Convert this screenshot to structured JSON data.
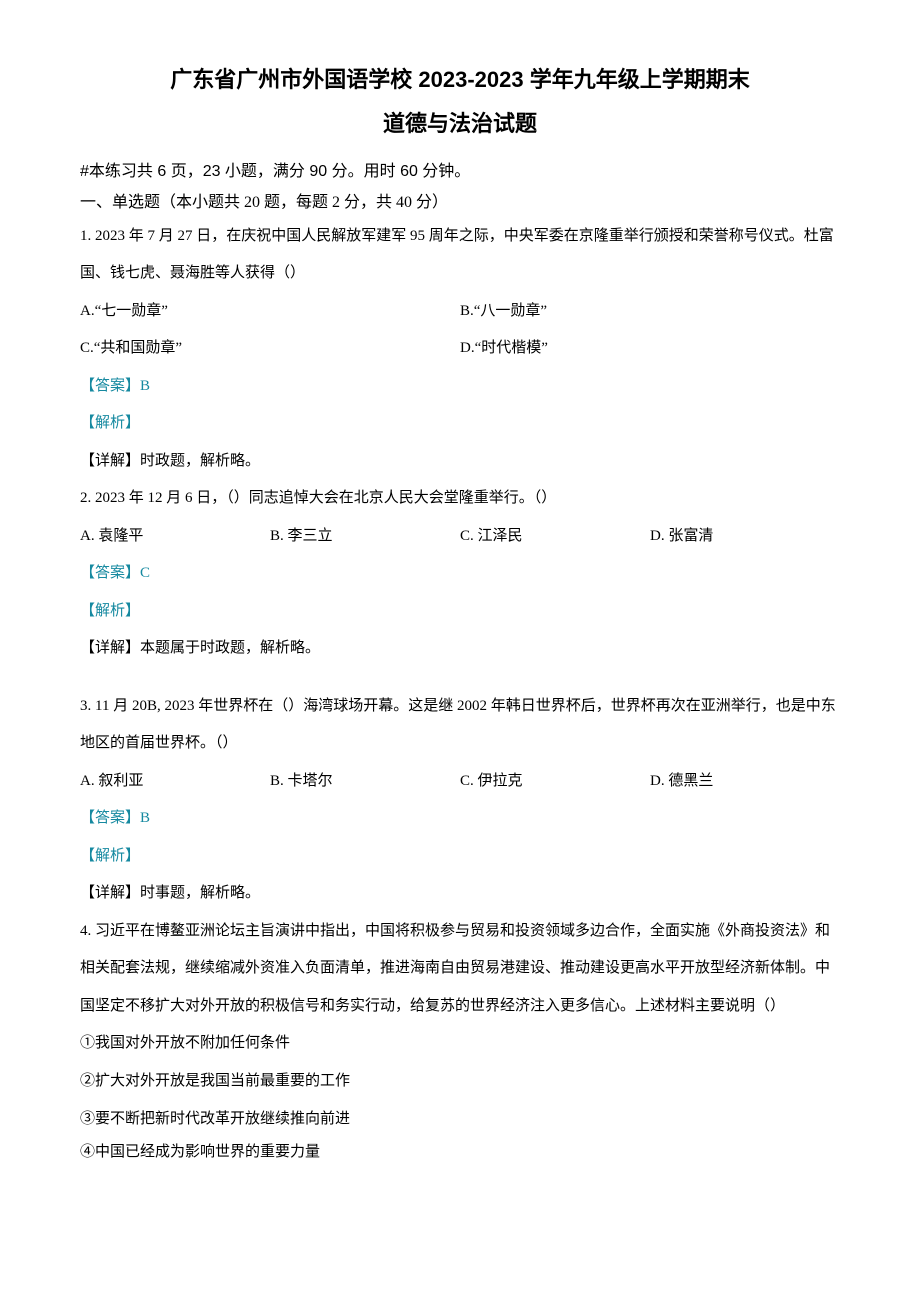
{
  "title_line1": "广东省广州市外国语学校 2023-2023 学年九年级上学期期末",
  "title_line2": "道德与法治试题",
  "meta_line": "#本练习共 6 页，23 小题，满分 90 分。用时 60 分钟。",
  "section1": "一、单选题（本小题共 20 题，每题 2 分，共 40 分）",
  "labels": {
    "answer_prefix": "【答案】",
    "analysis": "【解析】",
    "detail_prefix": "【详解】"
  },
  "q1": {
    "text": "1.  2023 年 7 月 27 日，在庆祝中国人民解放军建军 95 周年之际，中央军委在京隆重举行颁授和荣誉称号仪式。杜富国、钱七虎、聂海胜等人获得（）",
    "optA": "A.“七一勋章”",
    "optB": "B.“八一勋章”",
    "optC": "C.“共和国勋章”",
    "optD": "D.“时代楷模”",
    "answer": "B",
    "detail": "时政题，解析略。"
  },
  "q2": {
    "text": "2.  2023 年 12 月 6 日，（）同志追悼大会在北京人民大会堂隆重举行。（）",
    "optA": "A. 袁隆平",
    "optB": "B. 李三立",
    "optC": "C. 江泽民",
    "optD": "D. 张富清",
    "answer": "C",
    "detail": "本题属于时政题，解析略。"
  },
  "q3": {
    "text": "3. 11 月 20B, 2023 年世界杯在（）海湾球场开幕。这是继 2002 年韩日世界杯后，世界杯再次在亚洲举行，也是中东地区的首届世界杯。（）",
    "optA": "A. 叙利亚",
    "optB": "B. 卡塔尔",
    "optC": "C. 伊拉克",
    "optD": "D. 德黑兰",
    "answer": "B",
    "detail": "时事题，解析略。"
  },
  "q4": {
    "text": "4. 习近平在博鳌亚洲论坛主旨演讲中指出，中国将积极参与贸易和投资领域多边合作，全面实施《外商投资法》和相关配套法规，继续缩减外资准入负面清单，推进海南自由贸易港建设、推动建设更高水平开放型经济新体制。中国坚定不移扩大对外开放的积极信号和务实行动，给复苏的世界经济注入更多信心。上述材料主要说明（）",
    "s1": "①我国对外开放不附加任何条件",
    "s2": "②扩大对外开放是我国当前最重要的工作",
    "s3": "③要不断把新时代改革开放继续推向前进",
    "s4": "④中国已经成为影响世界的重要力量"
  }
}
